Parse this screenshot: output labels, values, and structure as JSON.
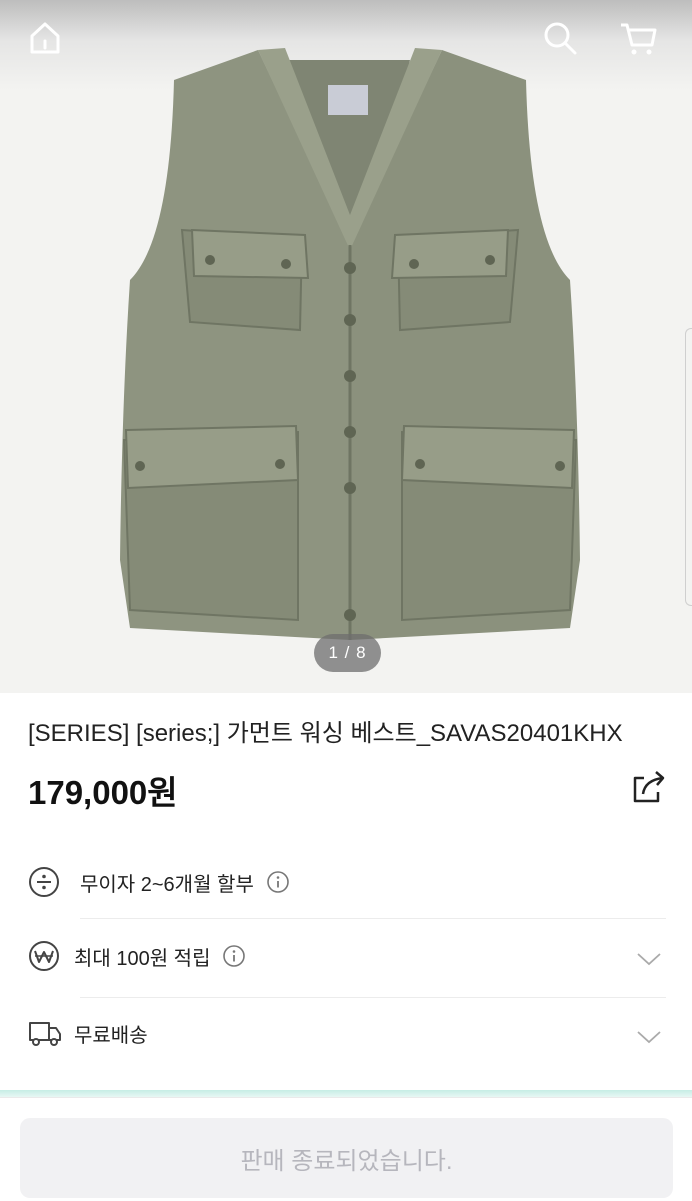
{
  "header": {
    "home_icon": "home-icon",
    "search_icon": "search-icon",
    "cart_icon": "cart-icon"
  },
  "gallery": {
    "image": "khaki utility vest",
    "counter": "1 / 8",
    "current": 1,
    "total": 8
  },
  "product": {
    "title": "[SERIES] [series;] 가먼트 워싱 베스트_SAVAS20401KHX",
    "price": "179,000원",
    "share_icon": "share-icon"
  },
  "benefits": [
    {
      "icon": "installment-divide-icon",
      "label": "무이자 2~6개월 할부",
      "info_icon": "info-icon",
      "expandable": false
    },
    {
      "icon": "won-coin-icon",
      "label": "최대 100원 적립",
      "info_icon": "info-icon",
      "expandable": true
    },
    {
      "icon": "truck-icon",
      "label": "무료배송",
      "expandable": true
    }
  ],
  "footer": {
    "soldout_label": "판매 종료되었습니다."
  },
  "colors": {
    "gallery_bg": "#f3f3f1",
    "vest": "#8e9480",
    "soldout_bg": "#f1f1f3",
    "soldout_text": "#b6b6bd",
    "accent_mint": "#a0e1d4"
  }
}
